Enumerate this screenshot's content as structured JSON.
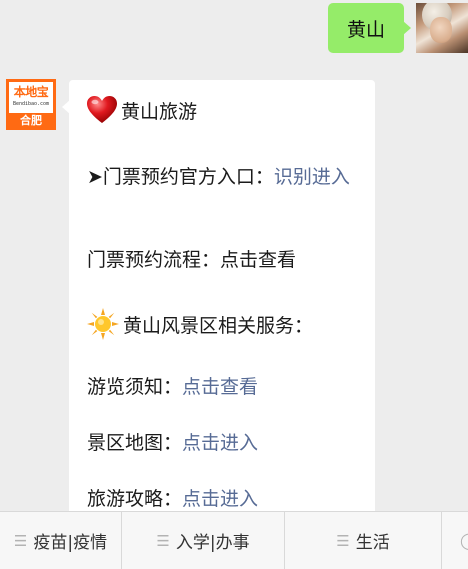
{
  "user_message": {
    "text": "黄山"
  },
  "bot_avatar": {
    "logo_main": "本地宝",
    "logo_sub": "Bendibao.com",
    "city": "合肥"
  },
  "card": {
    "title": "黄山旅游",
    "rows": [
      {
        "prefix": "➤门票预约官方入口：",
        "link": "识别进入"
      },
      {
        "text": "门票预约流程：点击查看"
      },
      {
        "heading": "黄山风景区相关服务："
      },
      {
        "prefix": "游览须知：",
        "link": "点击查看"
      },
      {
        "prefix": "景区地图：",
        "link": "点击进入"
      },
      {
        "prefix": "旅游攻略：",
        "link": "点击进入"
      }
    ]
  },
  "menu": {
    "items": [
      {
        "label": "疫苗|疫情",
        "icon": "menu-lines-icon"
      },
      {
        "label": "入学|办事",
        "icon": "menu-lines-icon"
      },
      {
        "label": "生活",
        "icon": "menu-lines-icon"
      },
      {
        "label": "",
        "icon": "circle-icon"
      }
    ]
  },
  "colors": {
    "user_bubble": "#95ec69",
    "link": "#576b95",
    "brand_orange": "#ff6a13",
    "background": "#ededed"
  }
}
